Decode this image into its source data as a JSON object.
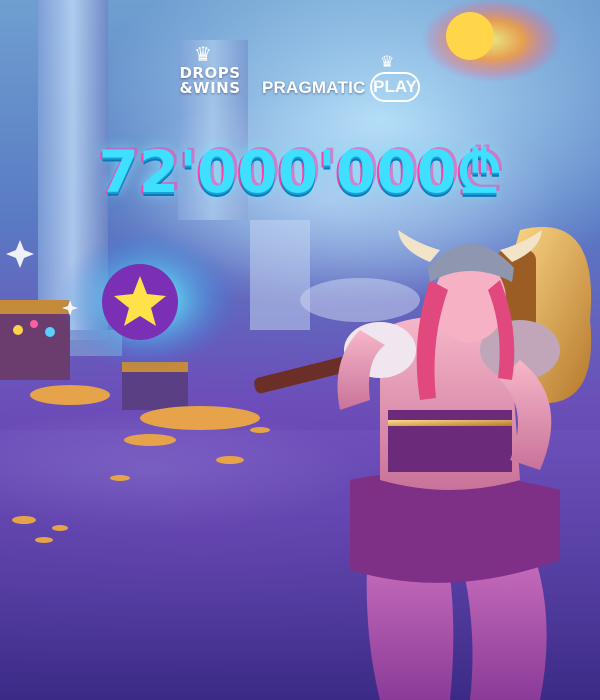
{
  "logos": {
    "drops_wins_line1": "DROPS",
    "drops_wins_line2": "&WINS",
    "provider_name": "PRAGMATIC",
    "provider_play": "PLAY"
  },
  "prize": {
    "amount": "72'000'000₾"
  },
  "icons": [
    "crown-icon",
    "star-orb-icon",
    "fire-orb-icon"
  ],
  "colors": {
    "prize_cyan": "#3fe0ff",
    "prize_pink": "#ff3fa8",
    "background_purple": "#4e3a9c",
    "background_blue": "#6f9fd0"
  }
}
